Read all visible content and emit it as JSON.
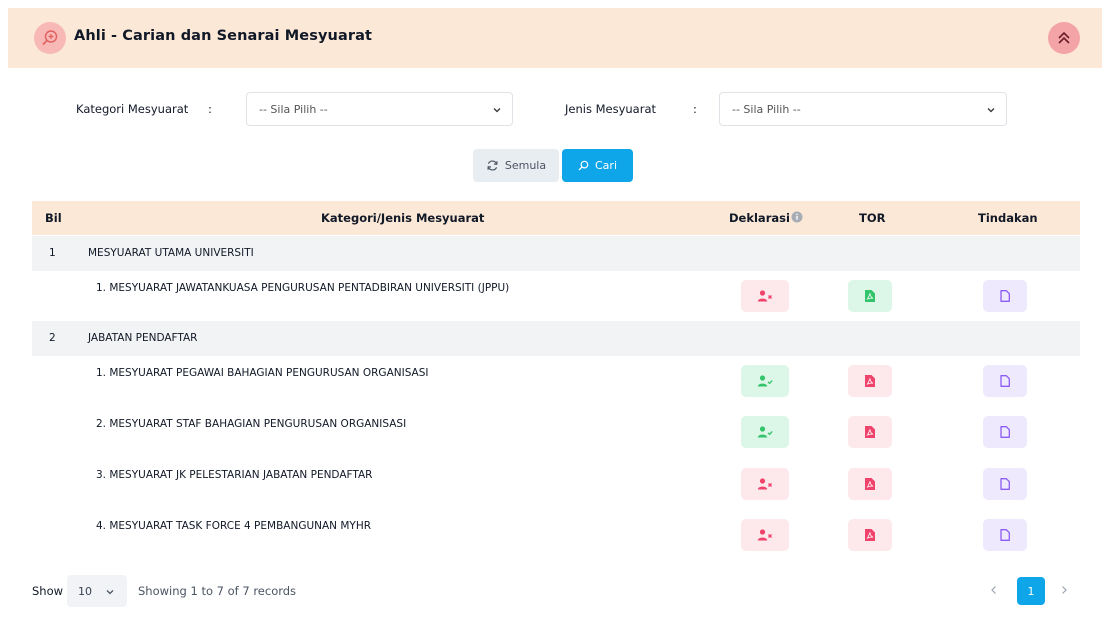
{
  "header": {
    "title": "Ahli - Carian dan Senarai Mesyuarat",
    "icon": "search-plus-icon",
    "collapse_icon": "chevron-double-up-icon"
  },
  "filters": {
    "kategori_label": "Kategori Mesyuarat",
    "kategori_colon": ":",
    "kategori_value": "-- Sila Pilih --",
    "jenis_label": "Jenis Mesyuarat",
    "jenis_colon": ":",
    "jenis_value": "-- Sila Pilih --"
  },
  "buttons": {
    "reset_label": "Semula",
    "search_label": "Cari"
  },
  "table": {
    "columns": {
      "bil": "Bil",
      "kategori": "Kategori/Jenis Mesyuarat",
      "deklarasi": "Deklarasi",
      "tor": "TOR",
      "tindakan": "Tindakan"
    },
    "groups": [
      {
        "bil": "1",
        "name": "MESYUARAT UTAMA UNIVERSITI",
        "items": [
          {
            "name": "1. MESYUARAT JAWATANKUASA PENGURUSAN PENTADBIRAN UNIVERSITI (JPPU)",
            "deklarasi": "not-declared",
            "tor": "available"
          }
        ]
      },
      {
        "bil": "2",
        "name": "JABATAN PENDAFTAR",
        "items": [
          {
            "name": "1. MESYUARAT PEGAWAI BAHAGIAN PENGURUSAN ORGANISASI",
            "deklarasi": "declared",
            "tor": "unavailable"
          },
          {
            "name": "2. MESYUARAT STAF BAHAGIAN PENGURUSAN ORGANISASI",
            "deklarasi": "declared",
            "tor": "unavailable"
          },
          {
            "name": "3. MESYUARAT JK PELESTARIAN JABATAN PENDAFTAR",
            "deklarasi": "not-declared",
            "tor": "unavailable"
          },
          {
            "name": "4. MESYUARAT TASK FORCE 4 PEMBANGUNAN MYHR",
            "deklarasi": "not-declared",
            "tor": "unavailable"
          }
        ]
      }
    ]
  },
  "footer": {
    "show_label": "Show",
    "page_length": "10",
    "showing_text": "Showing 1 to 7 of 7 records",
    "current_page": "1"
  },
  "colors": {
    "header_bg": "#fbe8d6",
    "accent": "#0ea5e9",
    "danger": "#f0436c",
    "success": "#34c46b",
    "purple": "#8b5cf6"
  }
}
